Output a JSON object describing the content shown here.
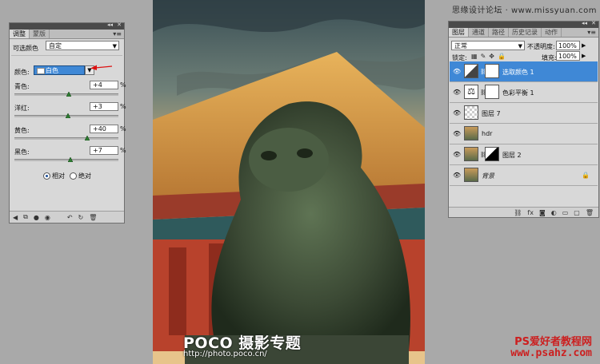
{
  "watermark_top": "思缘设计论坛 · www.missyuan.com",
  "watermark_bottom": {
    "line1": "PS爱好者教程网",
    "line2": "www.psahz.com"
  },
  "adjustments": {
    "tabs": [
      "调整",
      "蒙版"
    ],
    "preset_label": "可选颜色",
    "preset_value": "自定",
    "color_label": "颜色:",
    "color_value": "白色",
    "sliders": [
      {
        "label": "青色:",
        "value": "+4",
        "unit": "%",
        "position": 0.52
      },
      {
        "label": "洋红:",
        "value": "+3",
        "unit": "%",
        "position": 0.515
      },
      {
        "label": "黄色:",
        "value": "+40",
        "unit": "%",
        "position": 0.7
      },
      {
        "label": "黑色:",
        "value": "+7",
        "unit": "%",
        "position": 0.535
      }
    ],
    "mode_options": [
      {
        "label": "相对",
        "selected": true
      },
      {
        "label": "绝对",
        "selected": false
      }
    ]
  },
  "photo": {
    "logo": "POCO 摄影专题",
    "url": "http://photo.poco.cn/"
  },
  "layers_panel": {
    "tabs": [
      "图层",
      "通道",
      "路径",
      "历史记录",
      "动作"
    ],
    "blend_mode": "正常",
    "opacity_label": "不透明度:",
    "opacity_value": "100%",
    "lock_label": "锁定:",
    "fill_label": "填充:",
    "fill_value": "100%",
    "layers": [
      {
        "name": "选取颜色 1",
        "selected": true
      },
      {
        "name": "色彩平衡 1",
        "selected": false
      },
      {
        "name": "图层 7",
        "selected": false
      },
      {
        "name": "hdr",
        "selected": false
      },
      {
        "name": "图层 2",
        "selected": false
      },
      {
        "name": "背景",
        "selected": false
      }
    ]
  },
  "colors": {
    "selection_blue": "#3f88d6",
    "panel_gray": "#d8d8d8",
    "accent_red": "#cc1f1f"
  }
}
